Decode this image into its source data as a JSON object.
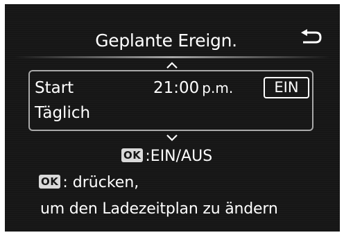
{
  "header": {
    "title": "Geplante Ereign.",
    "back_icon": "return-arrow-icon"
  },
  "schedule": {
    "start_label": "Start",
    "time": "21:00",
    "ampm": "p.m.",
    "status": "EIN",
    "frequency": "Täglich"
  },
  "scroll": {
    "up_icon": "chevron-up-icon",
    "down_icon": "chevron-down-icon"
  },
  "hints": {
    "ok_badge": "OK",
    "toggle_text": ":EIN/AUS",
    "press_text": ": drücken,",
    "change_text": "um den Ladezeitplan zu ändern"
  },
  "colors": {
    "background": "#161616",
    "text": "#ffffff",
    "frame": "#a9a9a9"
  }
}
